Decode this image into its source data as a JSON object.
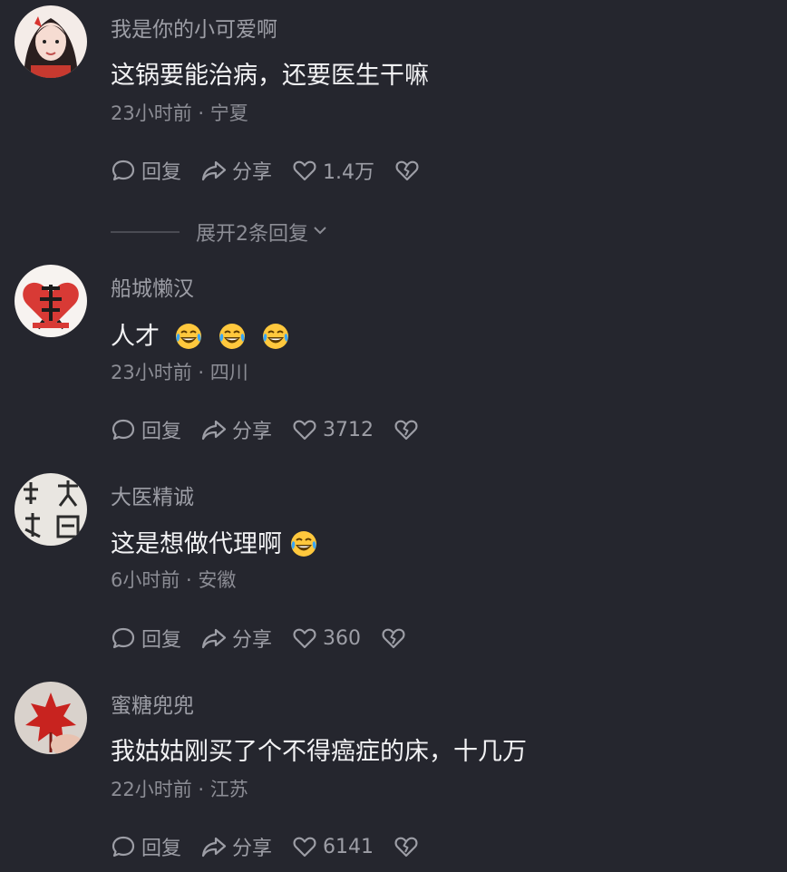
{
  "comments": [
    {
      "username": "我是你的小可爱啊",
      "text": "这锅要能治病，还要医生干嘛",
      "emoji_count": 0,
      "meta": "23小时前 · 宁夏",
      "reply_label": "回复",
      "share_label": "分享",
      "likes": "1.4万"
    },
    {
      "username": "船城懒汉",
      "text": "人才",
      "emoji_count": 3,
      "meta": "23小时前 · 四川",
      "reply_label": "回复",
      "share_label": "分享",
      "likes": "3712"
    },
    {
      "username": "大医精诚",
      "text": "这是想做代理啊",
      "emoji_count": 1,
      "meta": "6小时前 · 安徽",
      "reply_label": "回复",
      "share_label": "分享",
      "likes": "360"
    },
    {
      "username": "蜜糖兜兜",
      "text": "我姑姑刚买了个不得癌症的床，十几万",
      "emoji_count": 0,
      "meta": "22小时前 · 江苏",
      "reply_label": "回复",
      "share_label": "分享",
      "likes": "6141"
    }
  ],
  "expand_replies": {
    "label": "展开2条回复"
  },
  "icons": {
    "reply": "speech-bubble-icon",
    "share": "share-arrow-icon",
    "like": "heart-icon",
    "dislike": "broken-heart-icon",
    "emoji": "laughing-tears-emoji",
    "expand": "chevron-down-icon"
  },
  "colors": {
    "background": "#25262e",
    "primary_text": "#f2f2f4",
    "secondary_text": "#9d9ea6"
  }
}
